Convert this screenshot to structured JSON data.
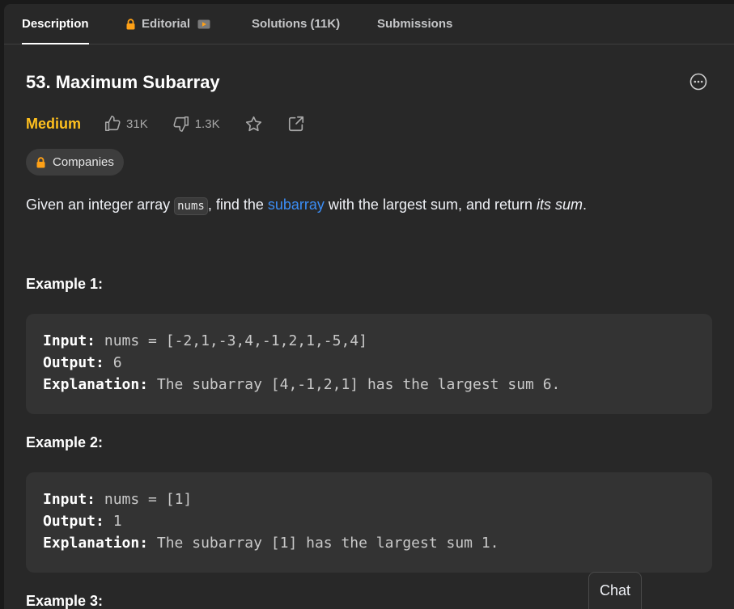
{
  "tabs": [
    {
      "label": "Description",
      "active": true
    },
    {
      "label": "Editorial",
      "locked": true,
      "has_video": true
    },
    {
      "label": "Solutions (11K)"
    },
    {
      "label": "Submissions"
    }
  ],
  "problem": {
    "title": "53. Maximum Subarray",
    "difficulty": "Medium",
    "likes": "31K",
    "dislikes": "1.3K",
    "companies_label": "Companies",
    "description": {
      "part1": "Given an integer array ",
      "code": "nums",
      "part2": ", find the ",
      "link": "subarray",
      "part3": " with the largest sum, and return ",
      "emphasis": "its sum",
      "part4": "."
    }
  },
  "examples": [
    {
      "title": "Example 1:",
      "input_label": "Input:",
      "input": " nums = [-2,1,-3,4,-1,2,1,-5,4]",
      "output_label": "Output:",
      "output": " 6",
      "explanation_label": "Explanation:",
      "explanation": " The subarray [4,-1,2,1] has the largest sum 6."
    },
    {
      "title": "Example 2:",
      "input_label": "Input:",
      "input": " nums = [1]",
      "output_label": "Output:",
      "output": " 1",
      "explanation_label": "Explanation:",
      "explanation": " The subarray [1] has the largest sum 1."
    },
    {
      "title": "Example 3:"
    }
  ],
  "chat_label": "Chat",
  "colors": {
    "difficulty_medium": "#ffc01e",
    "link": "#3b8df5",
    "lock": "#ffa116",
    "background": "#282828"
  }
}
